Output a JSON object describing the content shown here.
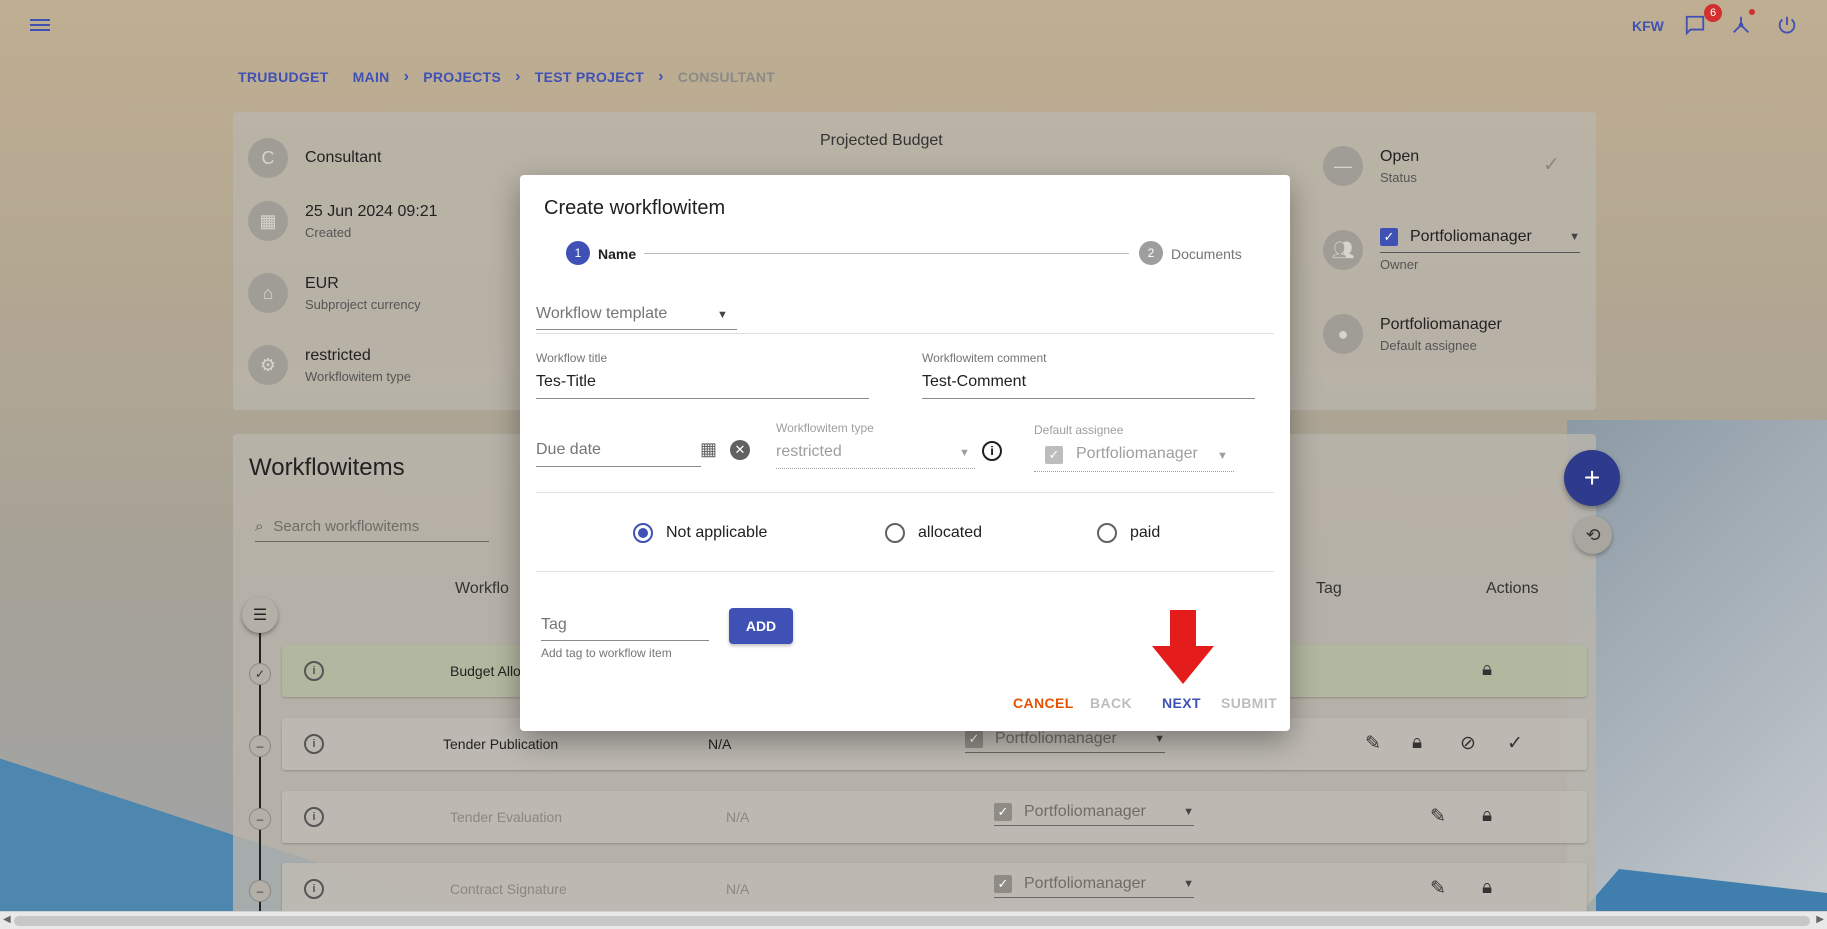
{
  "topbar": {
    "org": "KFW",
    "notification_count": "6",
    "icons": [
      "menu-icon",
      "chat-icon",
      "network-icon",
      "power-icon"
    ]
  },
  "breadcrumb": [
    "TRUBUDGET",
    "MAIN",
    "PROJECTS",
    "TEST PROJECT",
    "CONSULTANT"
  ],
  "subproject": {
    "avatar_letter": "C",
    "name": "Consultant",
    "created": "25 Jun 2024 09:21",
    "created_label": "Created",
    "currency": "EUR",
    "currency_label": "Subproject currency",
    "workflowitem_type": "restricted",
    "workflowitem_type_label": "Workflowitem type",
    "projected_budget": "Projected Budget",
    "status": "Open",
    "status_label": "Status",
    "owner": "Portfoliomanager",
    "owner_label": "Owner",
    "default_assignee": "Portfoliomanager",
    "default_assignee_label": "Default assignee"
  },
  "workflowitems": {
    "title": "Workflowitems",
    "search_placeholder": "Search workflowitems",
    "columns": {
      "workflow": "Workflo",
      "tag": "Tag",
      "actions": "Actions"
    },
    "rows": [
      {
        "name": "Budget Allo",
        "amount": "",
        "assignee": "",
        "status": "done"
      },
      {
        "name": "Tender Publication",
        "amount": "N/A",
        "assignee": "Portfoliomanager",
        "status": "open"
      },
      {
        "name": "Tender Evaluation",
        "amount": "N/A",
        "assignee": "Portfoliomanager",
        "status": "pending"
      },
      {
        "name": "Contract Signature",
        "amount": "N/A",
        "assignee": "Portfoliomanager",
        "status": "pending"
      }
    ]
  },
  "dialog": {
    "title": "Create workflowitem",
    "steps": [
      {
        "number": "1",
        "label": "Name",
        "active": true
      },
      {
        "number": "2",
        "label": "Documents",
        "active": false
      }
    ],
    "template_placeholder": "Workflow template",
    "title_label": "Workflow title",
    "title_value": "Tes-Title",
    "comment_label": "Workflowitem comment",
    "comment_value": "Test-Comment",
    "due_date_placeholder": "Due date",
    "type_label": "Workflowitem type",
    "type_value": "restricted",
    "assignee_label": "Default assignee",
    "assignee_value": "Portfoliomanager",
    "budget_options": [
      {
        "label": "Not applicable",
        "selected": true
      },
      {
        "label": "allocated",
        "selected": false
      },
      {
        "label": "paid",
        "selected": false
      }
    ],
    "tag_placeholder": "Tag",
    "tag_helper": "Add tag to workflow item",
    "add_label": "ADD",
    "buttons": {
      "cancel": "CANCEL",
      "back": "BACK",
      "next": "NEXT",
      "submit": "SUBMIT"
    }
  },
  "colors": {
    "primary": "#3f51b5",
    "cancel": "#e65100",
    "badge": "#d32f2f",
    "arrow": "#e51c1c"
  }
}
